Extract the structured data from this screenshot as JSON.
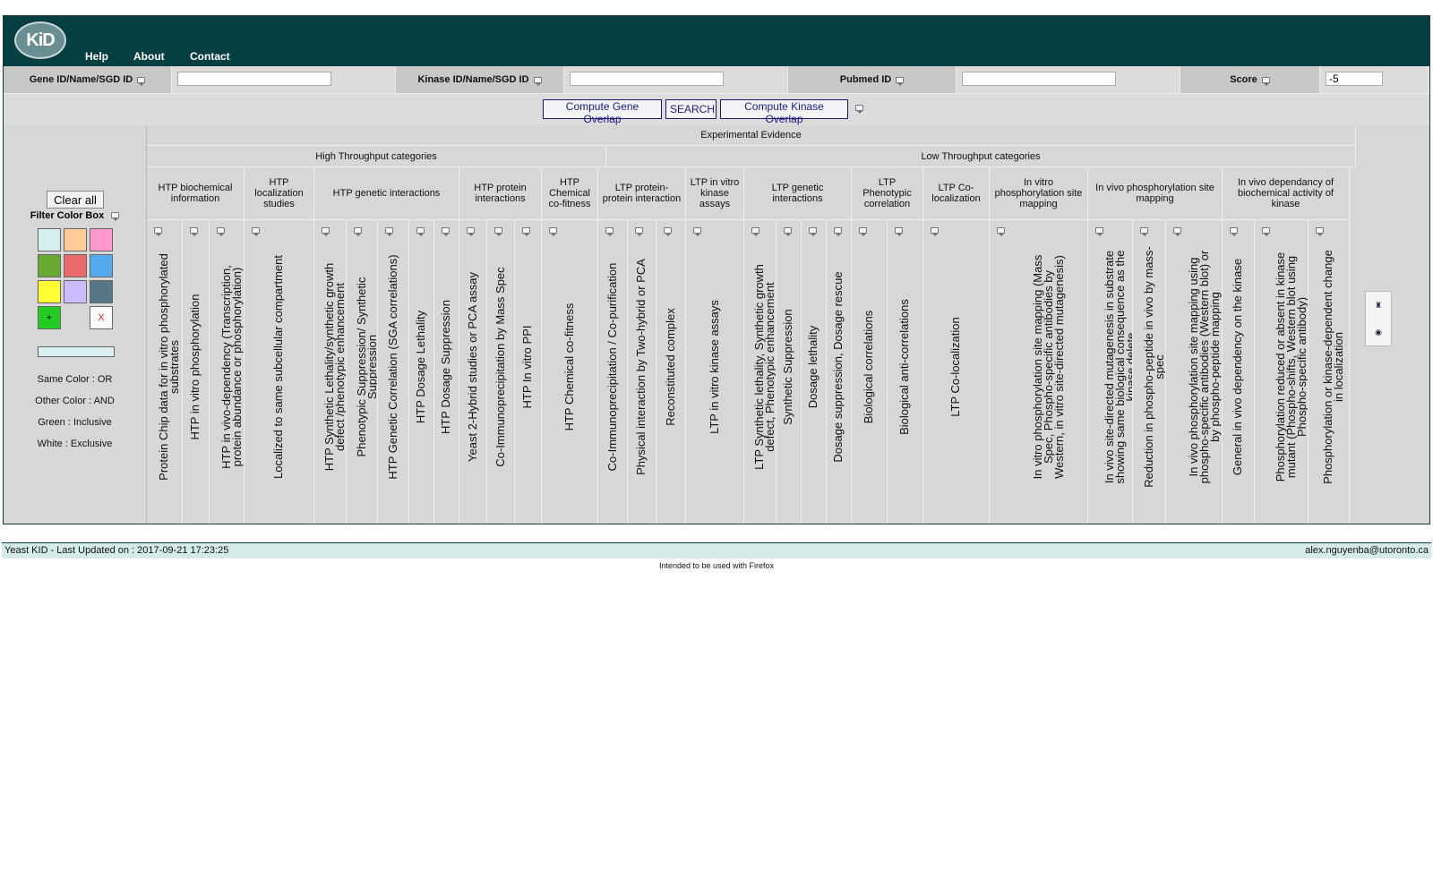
{
  "header": {
    "logo_text": "KiD",
    "nav": [
      "Help",
      "About",
      "Contact"
    ]
  },
  "search": {
    "gene_label": "Gene ID/Name/SGD ID",
    "gene_value": "",
    "kinase_label": "Kinase ID/Name/SGD ID",
    "kinase_value": "",
    "pubmed_label": "Pubmed ID",
    "pubmed_value": "",
    "score_label": "Score",
    "score_value": "-5"
  },
  "buttons": {
    "gene_overlap": "Compute Gene Overlap",
    "search": "SEARCH",
    "kinase_overlap": "Compute Kinase Overlap"
  },
  "filter": {
    "clear_all": "Clear all",
    "title": "Filter Color Box",
    "swatches": [
      {
        "color": "#d6eeee",
        "label": ""
      },
      {
        "color": "#ffcc99",
        "label": ""
      },
      {
        "color": "#ff99cc",
        "label": ""
      },
      {
        "color": "#66aa33",
        "label": ""
      },
      {
        "color": "#e86a6a",
        "label": ""
      },
      {
        "color": "#55aaee",
        "label": ""
      },
      {
        "color": "#ffff33",
        "label": ""
      },
      {
        "color": "#ccbbff",
        "label": ""
      },
      {
        "color": "#557788",
        "label": ""
      },
      {
        "color": "#22cc22",
        "label": "+"
      },
      {
        "color": "none",
        "label": ""
      },
      {
        "color": "#ffffff",
        "label": "X"
      }
    ],
    "legend": [
      "Same Color : OR",
      "Other Color : AND",
      "Green : Inclusive",
      "White : Exclusive"
    ]
  },
  "evidence": {
    "title": "Experimental Evidence",
    "htp_title": "High Throughput categories",
    "ltp_title": "Low Throughput categories",
    "groups": [
      "HTP biochemical information",
      "HTP localization studies",
      "HTP genetic interactions",
      "HTP protein interactions",
      "HTP Chemical co-fitness",
      "LTP protein-protein interaction",
      "LTP in vitro kinase assays",
      "LTP genetic interactions",
      "LTP Phenotypic correlation",
      "LTP Co-localization",
      "In vitro phosphorylation site mapping",
      "In vivo phosphorylation site mapping",
      "In vivo dependancy of biochemical activity of kinase"
    ],
    "columns": [
      "Protein Chip data for in vitro phosphorylated substrates",
      "HTP in vitro phosphorylation",
      "HTP in vivo-dependency (Transcription, protein abundance or phosphorylation)",
      "Localized to same subcellular compartment",
      "HTP Synthetic Lethality/synthetic growth defect /phenotypic enhancement",
      "Phenotypic Suppression/ Synthetic Suppression",
      "HTP Genetic Correlation (SGA correlations)",
      "HTP Dosage Lethality",
      "HTP Dosage Suppression",
      "Yeast 2-Hybrid studies or PCA assay",
      "Co-Immunoprecipitation by Mass Spec",
      "HTP In vitro PPI",
      "HTP Chemical co-fitness",
      "Co-Immunoprecipitation / Co-purification",
      "Physical interaction by Two-hybrid or PCA",
      "Reconstituted complex",
      "LTP in vitro kinase assays",
      "LTP Synthetic lethality, Synthetic growth defect, Phenotypic enhancement",
      "Synthetic Suppression",
      "Dosage lethality",
      "Dosage suppression, Dosage rescue",
      "Biological correlations",
      "Biological anti-correlations",
      "LTP Co-localization",
      "In vitro phosphorylation site mapping (Mass Spec, Phospho-specific antibodies by Western, in vitro site-directed mutagenesis)",
      "In vivo site-directed mutagenesis in substrate showing same biological consequence as the kinase delete",
      "Reduction in phospho-peptide in vivo by mass-spec",
      "In vivo phosphorylation site mapping using phospho-specific antibodies (Western blot) or by phospho-peptide mapping",
      "General in vivo dependency on the kinase",
      "Phosphorylation reduced or absent in kinase mutant (Phospho-shifts, Western blot using Phospho-specific antibody)",
      "Phosphorylation or kinase-dependent change in localization"
    ]
  },
  "footer": {
    "left": "Yeast KID - Last Updated on : 2017-09-21 17:23:25",
    "right": "alex.nguyenba@utoronto.ca",
    "note": "Intended to be used with Firefox"
  }
}
